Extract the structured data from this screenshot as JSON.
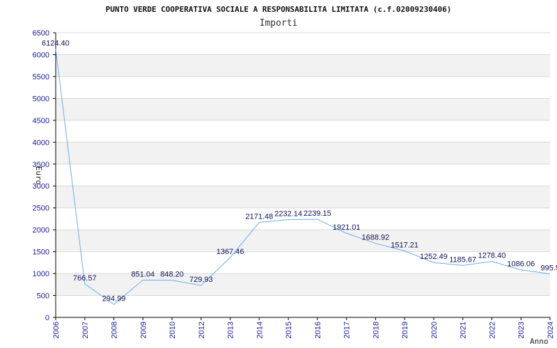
{
  "chart_data": {
    "type": "line",
    "title": "PUNTO VERDE COOPERATIVA SOCIALE A RESPONSABILITA LIMITATA (c.f.02009230406)",
    "subtitle": "Importi",
    "xlabel": "Anno",
    "ylabel": "Euro",
    "categories": [
      "2006",
      "2007",
      "2008",
      "2009",
      "2010",
      "2012",
      "2013",
      "2014",
      "2015",
      "2016",
      "2017",
      "2018",
      "2019",
      "2020",
      "2021",
      "2022",
      "2023",
      "2024"
    ],
    "series": [
      {
        "values": [
          6124.4,
          766.57,
          294.99,
          851.04,
          848.2,
          729.93,
          1367.46,
          2171.48,
          2232.14,
          2239.15,
          1921.01,
          1688.92,
          1517.21,
          1252.49,
          1185.67,
          1278.4,
          1086.06,
          995.5
        ]
      }
    ],
    "data_labels": [
      "6124.40",
      "766.57",
      "294.99",
      "851.04",
      "848.20",
      "729.93",
      "1367.46",
      "2171.48",
      "2232.14",
      "2239.15",
      "1921.01",
      "1688.92",
      "1517.21",
      "1252.49",
      "1185.67",
      "1278.40",
      "1086.06",
      "995.5"
    ],
    "ylim": [
      0,
      6500
    ],
    "yticks": [
      0,
      500,
      1000,
      1500,
      2000,
      2500,
      3000,
      3500,
      4000,
      4500,
      5000,
      5500,
      6000,
      6500
    ],
    "grid": true,
    "colors": {
      "line": "#6aaee8",
      "band": "#f2f2f2",
      "gridline": "#d8d8d8",
      "axis": "#000000",
      "tick_text": "#1a1aa0"
    }
  }
}
